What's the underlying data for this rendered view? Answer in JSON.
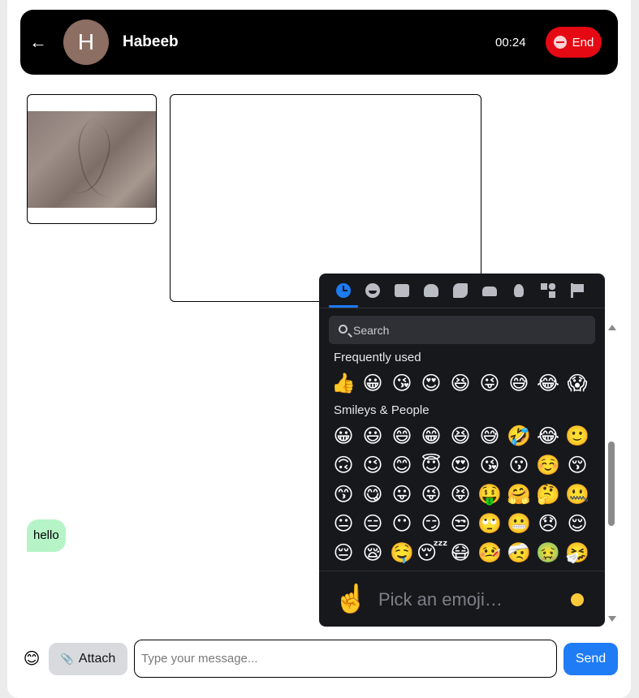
{
  "header": {
    "back_icon": "←",
    "avatar_initial": "H",
    "peer_name": "Habeeb",
    "timer": "00:24",
    "end_label": "End",
    "colors": {
      "bar": "#000000",
      "end": "#e50914",
      "avatar": "#8d6e63"
    }
  },
  "messages": [
    {
      "text": "hello",
      "bubble_color": "#b6f4c8"
    }
  ],
  "emoji_picker": {
    "categories": [
      "clock-icon",
      "smiley-icon",
      "animal-icon",
      "food-icon",
      "activity-icon",
      "travel-icon",
      "objects-icon",
      "symbols-icon",
      "flag-icon"
    ],
    "active_category": "clock-icon",
    "search_placeholder": "Search",
    "sections": [
      {
        "title": "Frequently used",
        "rows": [
          [
            "👍",
            "😀",
            "😘",
            "😍",
            "😆",
            "😜",
            "😅",
            "😂",
            "😱"
          ]
        ]
      },
      {
        "title": "Smileys & People",
        "rows": [
          [
            "😀",
            "😃",
            "😄",
            "😁",
            "😆",
            "😅",
            "🤣",
            "😂",
            "🙂"
          ],
          [
            "🙃",
            "😉",
            "😊",
            "😇",
            "😍",
            "😘",
            "😗",
            "☺️",
            "😚"
          ],
          [
            "😙",
            "😋",
            "😛",
            "😜",
            "😝",
            "🤑",
            "🤗",
            "🤔",
            "🤐"
          ],
          [
            "😐",
            "😑",
            "😶",
            "😏",
            "😒",
            "🙄",
            "😬",
            "😞",
            "😌"
          ],
          [
            "😔",
            "😪",
            "🤤",
            "😴",
            "😷",
            "🤒",
            "🤕",
            "🤢",
            "🤧"
          ]
        ]
      }
    ],
    "preview_emoji": "☝️",
    "preview_text": "Pick an emoji…",
    "skin_tone_color": "#ffc93a"
  },
  "composer": {
    "emoji_button": "😊",
    "attach_icon": "📎",
    "attach_label": "Attach",
    "input_placeholder": "Type your message...",
    "input_value": "",
    "send_label": "Send",
    "send_color": "#1f7cf5"
  }
}
